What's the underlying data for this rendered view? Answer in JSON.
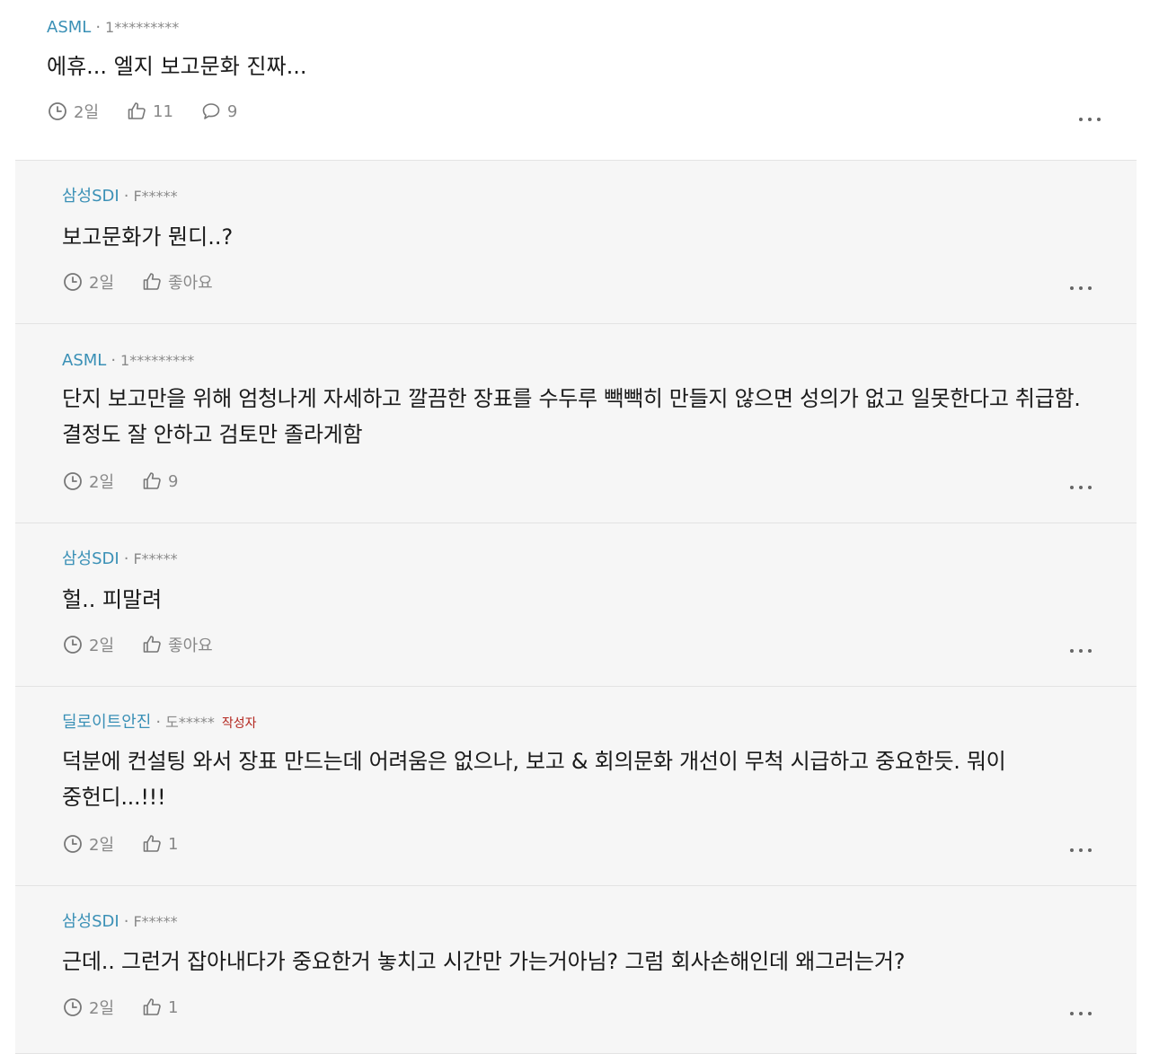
{
  "comments": [
    {
      "company": "ASML",
      "user": "1*********",
      "author_tag": "",
      "text": "에휴... 엘지 보고문화 진짜...",
      "time": "2일",
      "likes": "11",
      "replies": "9"
    },
    {
      "company": "삼성SDI",
      "user": "F*****",
      "author_tag": "",
      "text": "보고문화가 뭔디..?",
      "time": "2일",
      "likes": "좋아요"
    },
    {
      "company": "ASML",
      "user": "1*********",
      "author_tag": "",
      "text": "단지 보고만을 위해 엄청나게 자세하고 깔끔한 장표를 수두루 빽빽히 만들지 않으면 성의가 없고 일못한다고 취급함. 결정도 잘 안하고 검토만 졸라게함",
      "time": "2일",
      "likes": "9"
    },
    {
      "company": "삼성SDI",
      "user": "F*****",
      "author_tag": "",
      "text": "헐.. 피말려",
      "time": "2일",
      "likes": "좋아요"
    },
    {
      "company": "딜로이트안진",
      "user": "도*****",
      "author_tag": "작성자",
      "text": "덕분에 컨설팅 와서 장표 만드는데 어려움은 없으나, 보고 & 회의문화 개선이 무척 시급하고 중요한듯. 뭐이 중헌디...!!!",
      "time": "2일",
      "likes": "1"
    },
    {
      "company": "삼성SDI",
      "user": "F*****",
      "author_tag": "",
      "text": "근데.. 그런거 잡아내다가 중요한거 놓치고 시간만 가는거아님? 그럼 회사손해인데 왜그러는거?",
      "time": "2일",
      "likes": "1"
    }
  ],
  "icons": {
    "time": "clock-icon",
    "like": "thumbs-up-icon",
    "reply": "speech-bubble-icon",
    "more": "more-horizontal-icon"
  },
  "colors": {
    "company": "#3a90b6",
    "author_tag": "#b3261e",
    "muted": "#888888",
    "reply_background": "#f6f6f6"
  }
}
